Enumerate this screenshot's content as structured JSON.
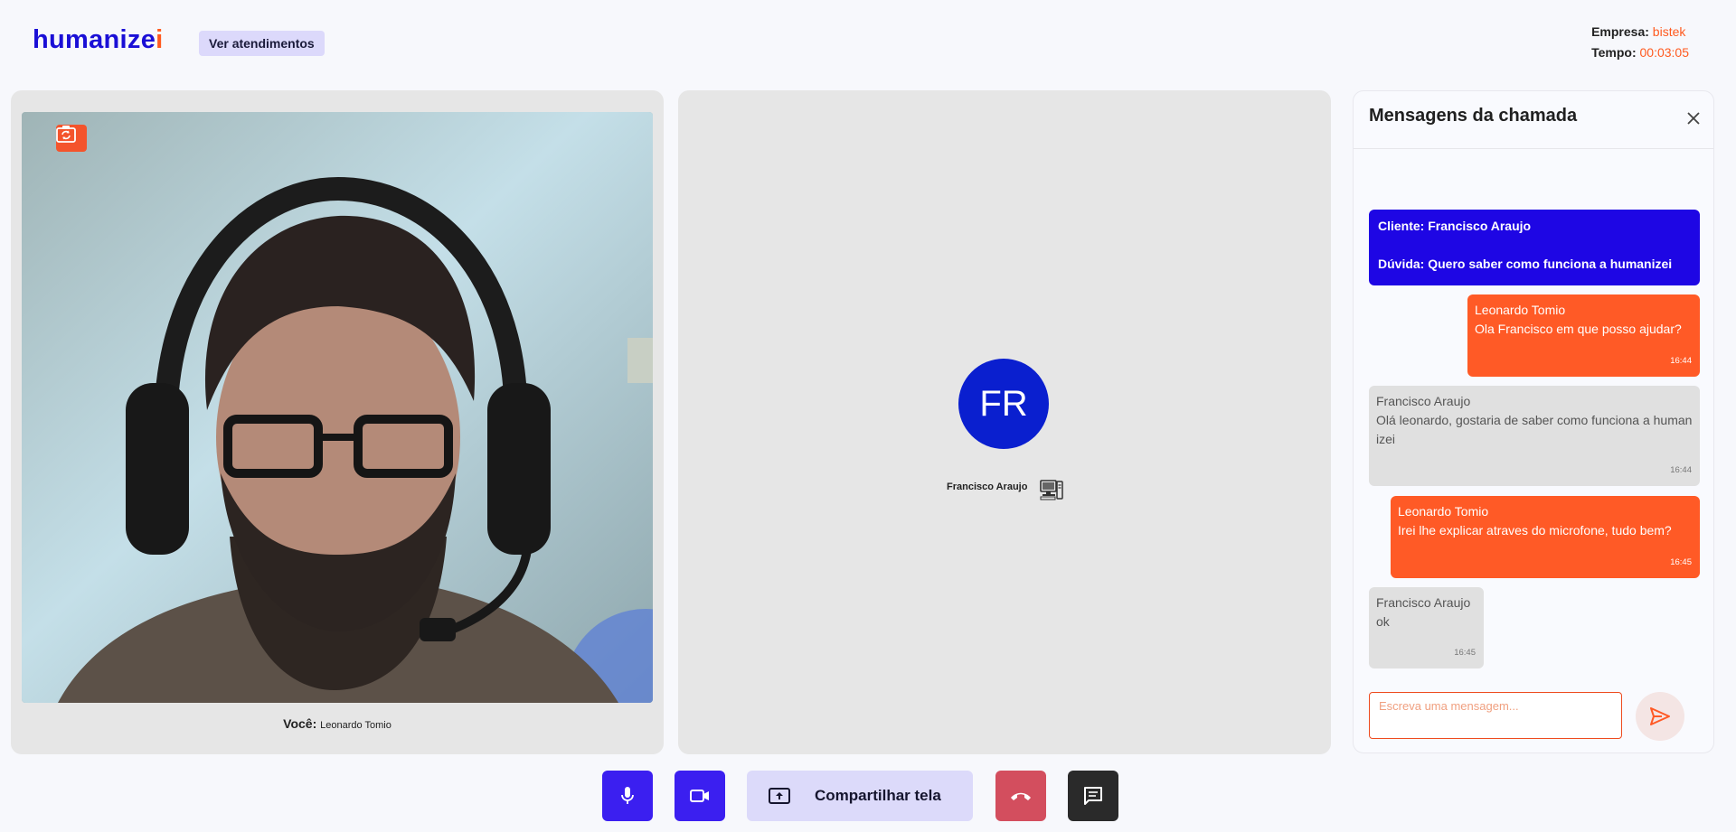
{
  "header": {
    "logo_main": "humanize",
    "logo_accent": "i",
    "ver_atendimentos_label": "Ver atendimentos",
    "empresa_label": "Empresa:",
    "empresa_value": "bistek",
    "tempo_label": "Tempo:",
    "tempo_value": "00:03:05"
  },
  "local": {
    "you_label": "Você:",
    "you_name": "Leonardo Tomio",
    "switch_camera_icon": "camera-switch-icon"
  },
  "remote": {
    "initials": "FR",
    "name": "Francisco Araujo",
    "device_icon": "desktop-computer-icon"
  },
  "chat": {
    "title": "Mensagens da chamada",
    "close_icon": "close-icon",
    "system_message": {
      "cliente": "Cliente: Francisco Araujo",
      "duvida": "Dúvida: Quero saber como funciona a humanizei"
    },
    "messages": [
      {
        "author": "Leonardo Tomio",
        "text": "Ola Francisco em que posso ajudar?",
        "time": "16:44",
        "from_me": true
      },
      {
        "author": "Francisco Araujo",
        "text": "Olá leonardo, gostaria de saber como funciona a humanizei",
        "time": "16:44",
        "from_me": false
      },
      {
        "author": "Leonardo Tomio",
        "text": "Irei lhe explicar atraves do microfone, tudo bem?",
        "time": "16:45",
        "from_me": true
      },
      {
        "author": "Francisco Araujo",
        "text": "ok",
        "time": "16:45",
        "from_me": false
      }
    ],
    "input_placeholder": "Escreva uma mensagem...",
    "send_icon": "send-icon"
  },
  "controls": {
    "mic_icon": "microphone-icon",
    "camera_icon": "video-camera-icon",
    "share_label": "Compartilhar tela",
    "share_icon": "screen-share-icon",
    "hangup_icon": "hang-up-icon",
    "chat_icon": "chat-icon"
  },
  "colors": {
    "brand_blue": "#1a0fd6",
    "accent_orange": "#ff5a1f",
    "hangup_red": "#d34e5e"
  }
}
